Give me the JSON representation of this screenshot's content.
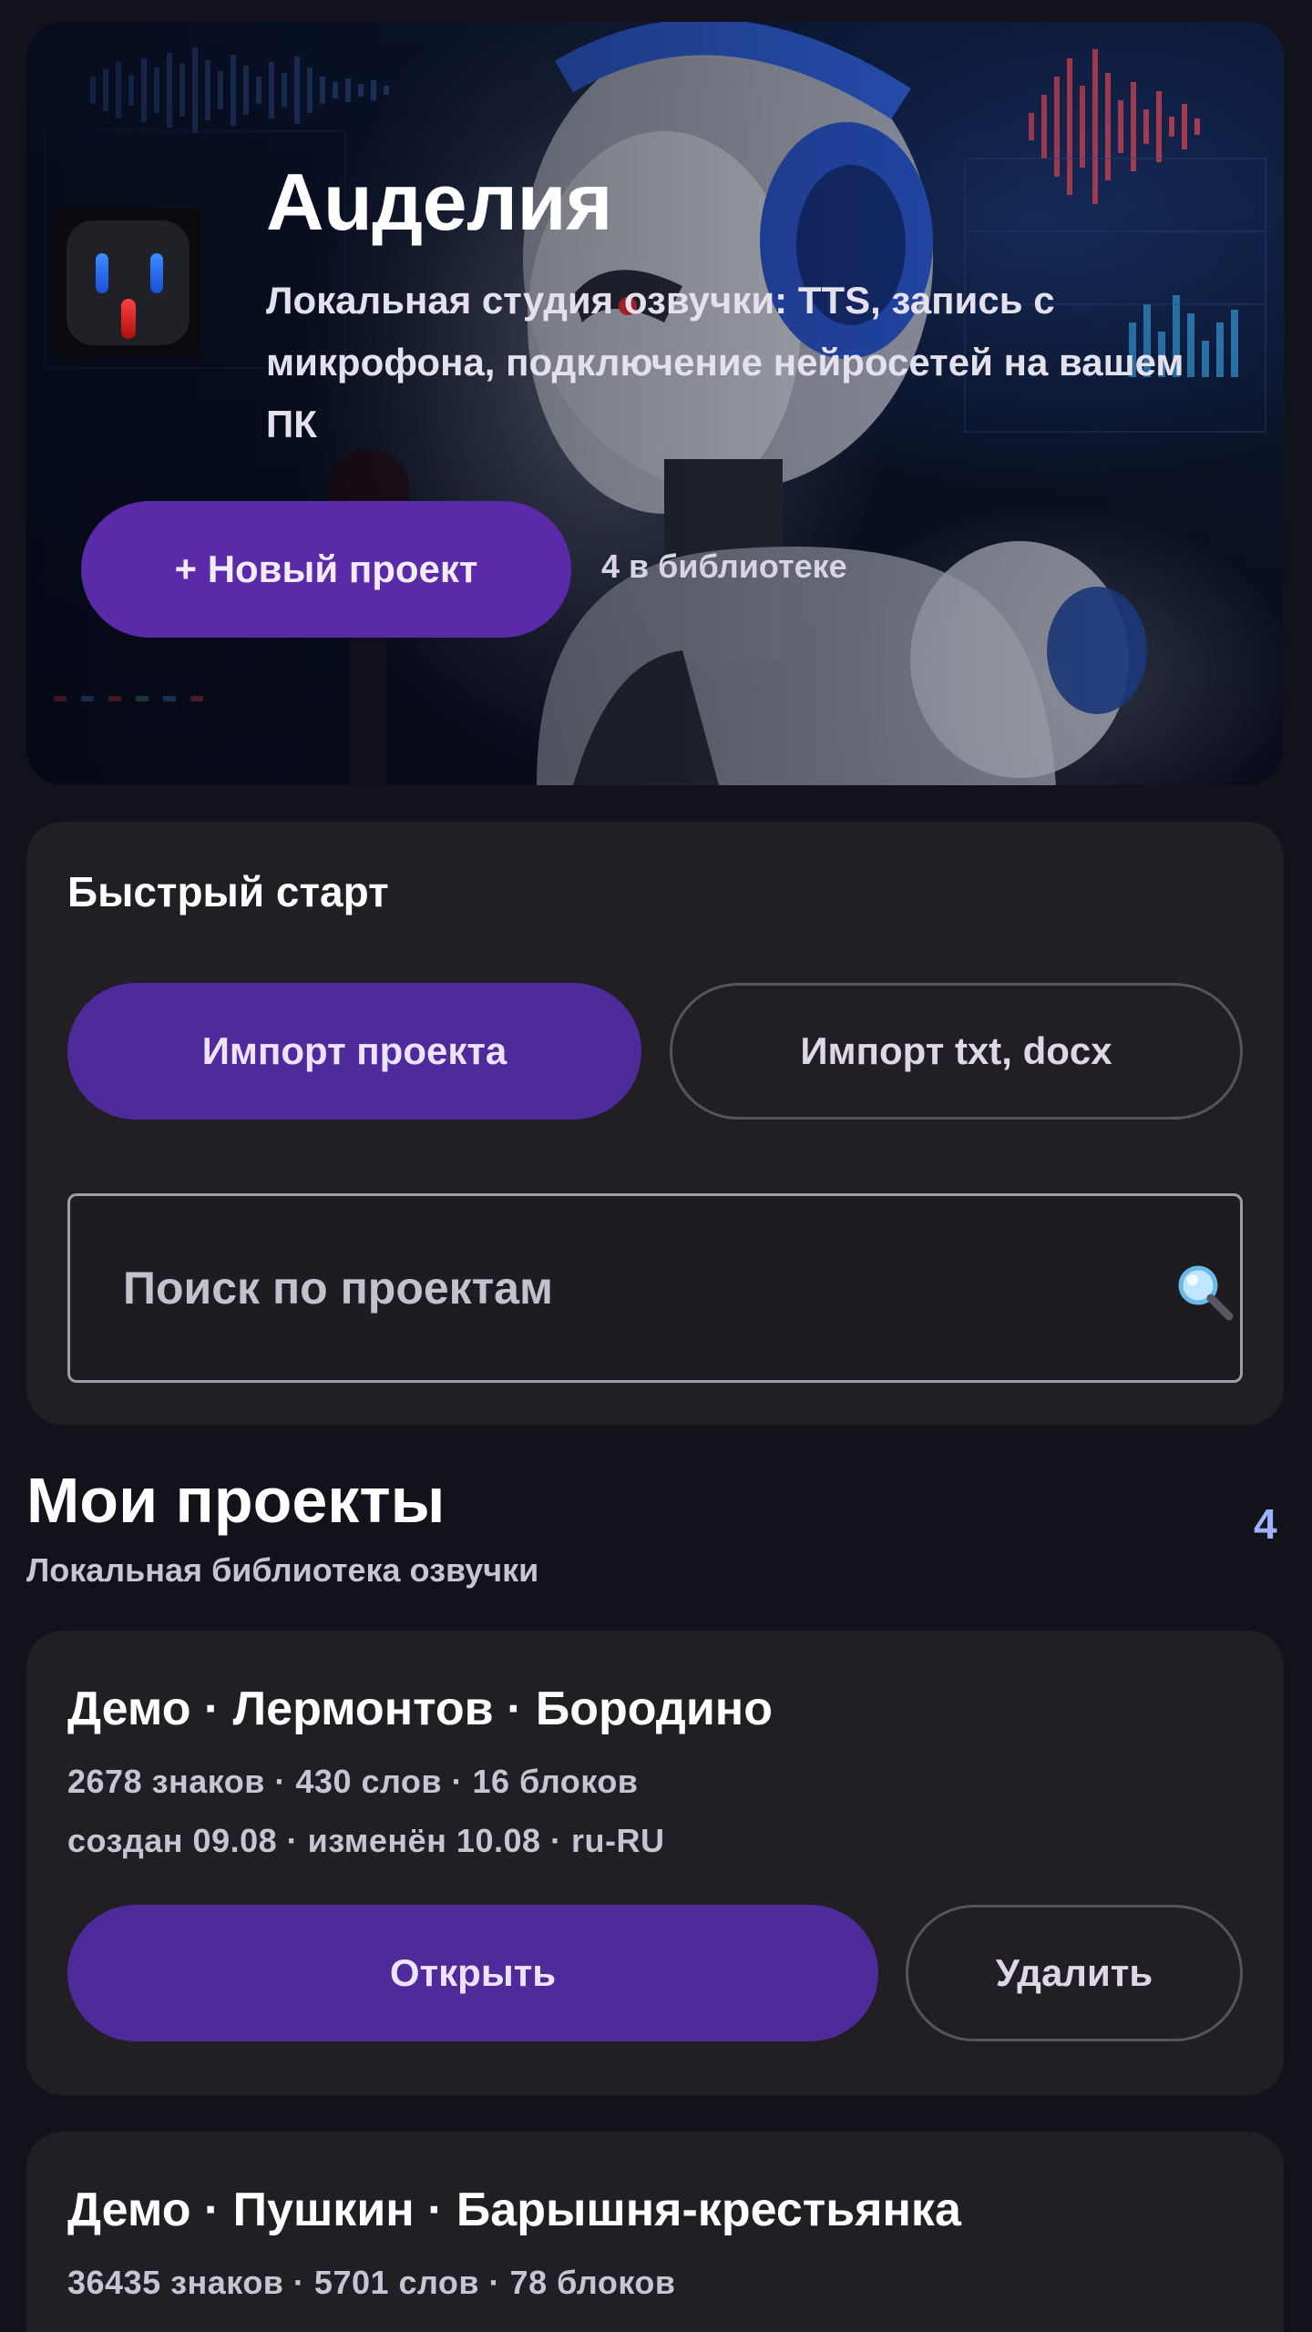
{
  "hero": {
    "title": "Auделия",
    "subtitle": "Локальная студия озвучки: TTS, запись с микрофона, подключение нейросетей на вашем ПК",
    "new_project_label": "+ Новый проект",
    "library_count": "4 в библиотеке",
    "logo_icon": "robot-face-icon",
    "colors": {
      "accent": "#5a2aa8",
      "eyes": "#2f6dff",
      "mouth": "#e02020"
    }
  },
  "quick_start": {
    "title": "Быстрый старт",
    "import_project_label": "Импорт проекта",
    "import_text_label": "Импорт txt, docx",
    "search": {
      "placeholder": "Поиск по проектам",
      "value": "",
      "icon": "magnifier-icon"
    }
  },
  "projects": {
    "title": "Мои проекты",
    "subtitle": "Локальная библиотека озвучки",
    "count": "4",
    "items": [
      {
        "title": "Демо · Лермонтов · Бородино",
        "stats": "2678 знаков · 430 слов · 16 блоков",
        "dates": "создан 09.08 · изменён 10.08 · ru-RU",
        "open_label": "Открыть",
        "delete_label": "Удалить"
      },
      {
        "title": "Демо · Пушкин · Барышня-крестьянка",
        "stats": "36435 знаков · 5701 слов · 78 блоков"
      }
    ]
  }
}
